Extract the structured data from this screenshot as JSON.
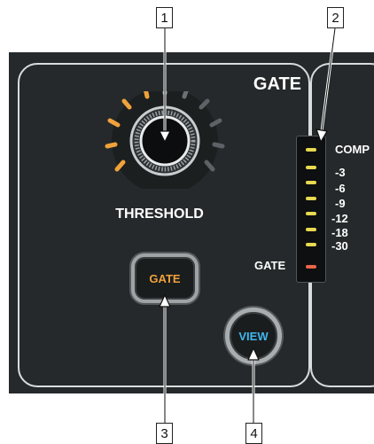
{
  "section": {
    "title": "GATE"
  },
  "threshold_knob": {
    "label": "THRESHOLD"
  },
  "buttons": {
    "gate_label": "GATE",
    "view_label": "VIEW"
  },
  "meter": {
    "labels": [
      "COMP",
      "-3",
      "-6",
      "-9",
      "-12",
      "-18",
      "-30"
    ],
    "gate_label": "GATE"
  },
  "callouts": [
    "1",
    "2",
    "3",
    "4"
  ],
  "colors": {
    "panel": "#25292b",
    "gate_button_text": "#f0a23a",
    "view_button_text": "#3fb8ef",
    "led_yellow": "#e8d850",
    "led_red": "#e8664a",
    "knob_ring_orange": "#f0a23a",
    "knob_ring_gray": "#5c6266"
  }
}
